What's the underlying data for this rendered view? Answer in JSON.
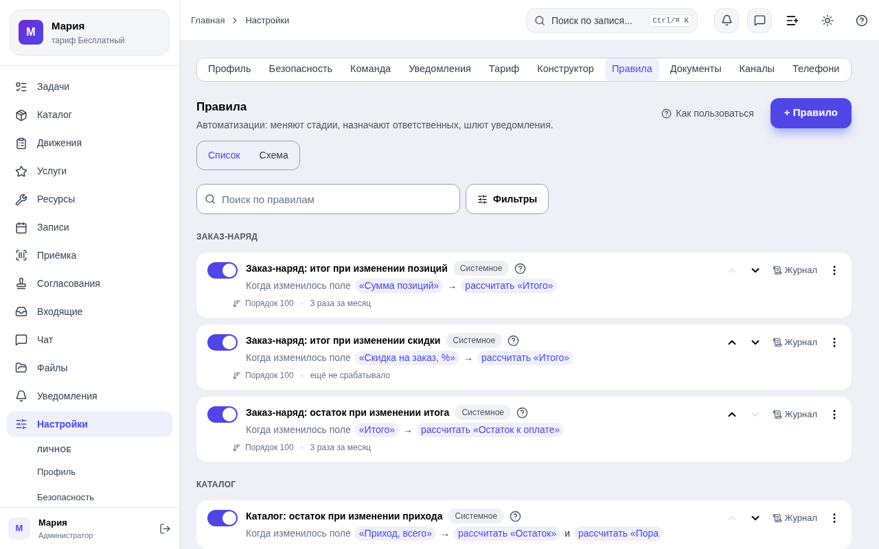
{
  "account": {
    "avatar": "М",
    "name": "Мария",
    "plan": "тариф Бесплатный"
  },
  "nav": [
    {
      "label": "Задачи",
      "selected": false
    },
    {
      "label": "Каталог",
      "selected": false
    },
    {
      "label": "Движения",
      "selected": false
    },
    {
      "label": "Услуги",
      "selected": false
    },
    {
      "label": "Ресурсы",
      "selected": false
    },
    {
      "label": "Записи",
      "selected": false
    },
    {
      "label": "Приёмка",
      "selected": false
    },
    {
      "label": "Согласования",
      "selected": false
    },
    {
      "label": "Входящие",
      "selected": false
    },
    {
      "label": "Чат",
      "selected": false
    },
    {
      "label": "Файлы",
      "selected": false
    },
    {
      "label": "Уведомления",
      "selected": false
    },
    {
      "label": "Настройки",
      "selected": true
    }
  ],
  "subnav": {
    "heading": "ЛИЧНОЕ",
    "items": [
      "Профиль",
      "Безопасность"
    ]
  },
  "user": {
    "avatar": "М",
    "name": "Мария",
    "role": "Администратор"
  },
  "breadcrumbs": [
    "Главная",
    "Настройки"
  ],
  "search": {
    "placeholder": "Поиск по запися...",
    "shortcut": "Ctrl/⌘ K"
  },
  "tabs": [
    {
      "label": "Профиль",
      "selected": false
    },
    {
      "label": "Безопасность",
      "selected": false
    },
    {
      "label": "Команда",
      "selected": false
    },
    {
      "label": "Уведомления",
      "selected": false
    },
    {
      "label": "Тариф",
      "selected": false
    },
    {
      "label": "Конструктор",
      "selected": false
    },
    {
      "label": "Правила",
      "selected": true
    },
    {
      "label": "Документы",
      "selected": false
    },
    {
      "label": "Каналы",
      "selected": false
    },
    {
      "label": "Телефони",
      "selected": false
    }
  ],
  "page": {
    "title": "Правила",
    "subtitle": "Автоматизации: меняют стадии, назначают ответственных, шлют уведомления.",
    "help": "Как пользоваться",
    "add_button": "+ Правило"
  },
  "views": [
    {
      "label": "Список",
      "selected": true
    },
    {
      "label": "Схема",
      "selected": false
    }
  ],
  "rule_search": {
    "placeholder": "Поиск по правилам"
  },
  "filters_button": "Фильтры",
  "groups": [
    {
      "title": "ЗАКАЗ-НАРЯД",
      "rules": [
        {
          "on": true,
          "title": "Заказ-наряд: итог при изменении позиций",
          "badge": "Системное",
          "when": "Когда изменилось поле",
          "parts": [
            {
              "kind": "chip",
              "text": "«Сумма позиций»"
            },
            {
              "kind": "plain",
              "text": "→"
            },
            {
              "kind": "chip",
              "text": "рассчитать «Итого»"
            }
          ],
          "order": "Порядок 100",
          "sep": "·",
          "runs": "3 раза за месяц",
          "up_disabled": true,
          "down_disabled": false,
          "journal": "Журнал"
        },
        {
          "on": true,
          "title": "Заказ-наряд: итог при изменении скидки",
          "badge": "Системное",
          "when": "Когда изменилось поле",
          "parts": [
            {
              "kind": "chip",
              "text": "«Скидка на заказ, %»"
            },
            {
              "kind": "plain",
              "text": "→"
            },
            {
              "kind": "chip",
              "text": "рассчитать «Итого»"
            }
          ],
          "order": "Порядок 100",
          "sep": "·",
          "runs": "ещё не срабатывало",
          "up_disabled": false,
          "down_disabled": false,
          "journal": "Журнал"
        },
        {
          "on": true,
          "title": "Заказ-наряд: остаток при изменении итога",
          "badge": "Системное",
          "when": "Когда изменилось поле",
          "parts": [
            {
              "kind": "chip",
              "text": "«Итого»"
            },
            {
              "kind": "plain",
              "text": "→"
            },
            {
              "kind": "chip",
              "text": "рассчитать «Остаток к оплате»"
            }
          ],
          "order": "Порядок 100",
          "sep": "·",
          "runs": "3 раза за месяц",
          "up_disabled": false,
          "down_disabled": true,
          "journal": "Журнал"
        }
      ]
    },
    {
      "title": "КАТАЛОГ",
      "rules": [
        {
          "on": true,
          "title": "Каталог: остаток при изменении прихода",
          "badge": "Системное",
          "when": "Когда изменилось поле",
          "parts": [
            {
              "kind": "chip",
              "text": "«Приход, всего»"
            },
            {
              "kind": "plain",
              "text": "→"
            },
            {
              "kind": "chip",
              "text": "рассчитать «Остаток»"
            },
            {
              "kind": "plain",
              "text": "и"
            },
            {
              "kind": "chip",
              "text": "рассчитать «Пора"
            }
          ],
          "up_disabled": true,
          "down_disabled": false,
          "journal": "Журнал"
        }
      ]
    }
  ]
}
